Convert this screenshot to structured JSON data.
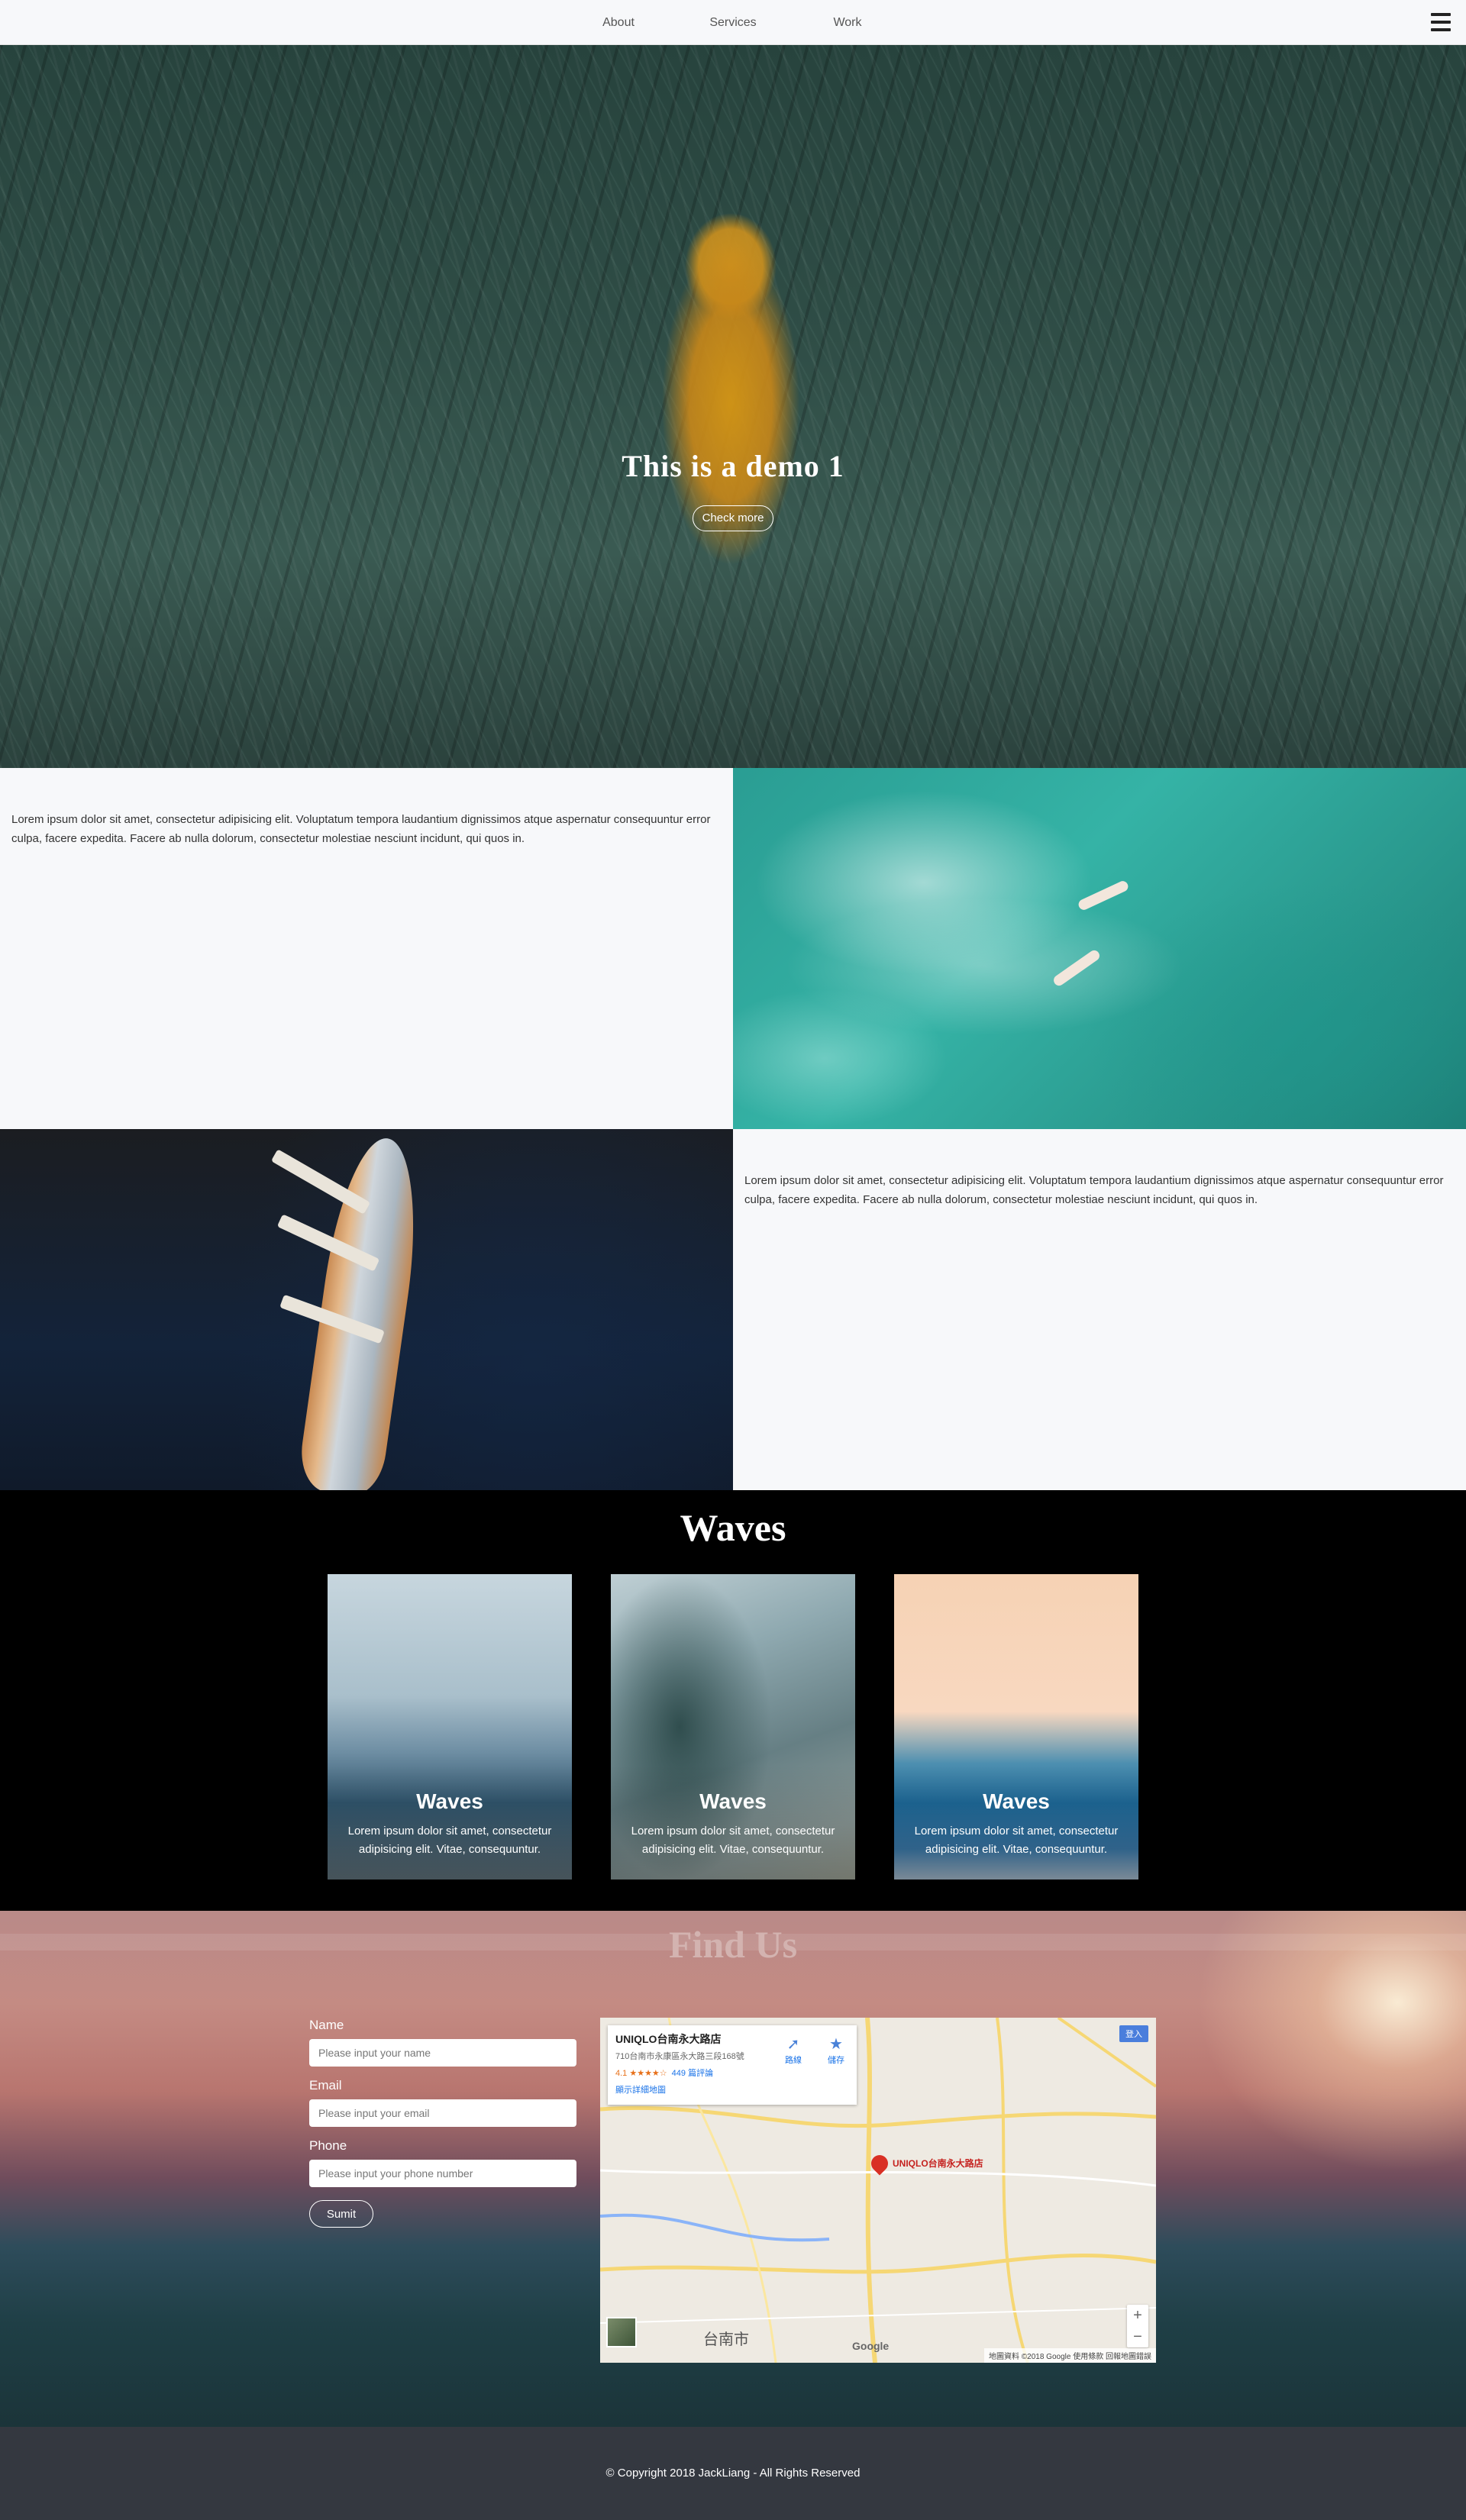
{
  "nav": {
    "links": [
      "About",
      "Services",
      "Work"
    ],
    "menu_icon": "hamburger-icon"
  },
  "hero": {
    "title": "This is a demo 1",
    "button": "Check more"
  },
  "features": [
    {
      "text": "Lorem ipsum dolor sit amet, consectetur adipisicing elit. Voluptatum tempora laudantium dignissimos atque aspernatur consequuntur error culpa, facere expedita. Facere ab nulla dolorum, consectetur molestiae nesciunt incidunt, qui quos in."
    },
    {
      "text": "Lorem ipsum dolor sit amet, consectetur adipisicing elit. Voluptatum tempora laudantium dignissimos atque aspernatur consequuntur error culpa, facere expedita. Facere ab nulla dolorum, consectetur molestiae nesciunt incidunt, qui quos in."
    }
  ],
  "waves": {
    "title": "Waves",
    "cards": [
      {
        "title": "Waves",
        "text": "Lorem ipsum dolor sit amet, consectetur adipisicing elit. Vitae, consequuntur."
      },
      {
        "title": "Waves",
        "text": "Lorem ipsum dolor sit amet, consectetur adipisicing elit. Vitae, consequuntur."
      },
      {
        "title": "Waves",
        "text": "Lorem ipsum dolor sit amet, consectetur adipisicing elit. Vitae, consequuntur."
      }
    ]
  },
  "findus": {
    "title": "Find Us",
    "form": {
      "name_label": "Name",
      "name_placeholder": "Please input your name",
      "email_label": "Email",
      "email_placeholder": "Please input your email",
      "phone_label": "Phone",
      "phone_placeholder": "Please input your phone number",
      "submit": "Sumit"
    },
    "map": {
      "place_name": "UNIQLO台南永大路店",
      "address": "710台南市永康區永大路三段168號",
      "rating": "4.1 ★★★★☆",
      "reviews": "449 篇評論",
      "view_larger": "顯示詳細地圖",
      "directions": "路線",
      "save": "儲存",
      "login": "登入",
      "pin_label": "UNIQLO台南永大路店",
      "city": "台南市",
      "zoom_in": "+",
      "zoom_out": "−",
      "logo": "Google",
      "attribution": "地圖資料 ©2018 Google   使用條款   回報地圖錯誤"
    }
  },
  "footer": {
    "copyright": "© Copyright 2018 JackLiang - All Rights Reserved"
  }
}
